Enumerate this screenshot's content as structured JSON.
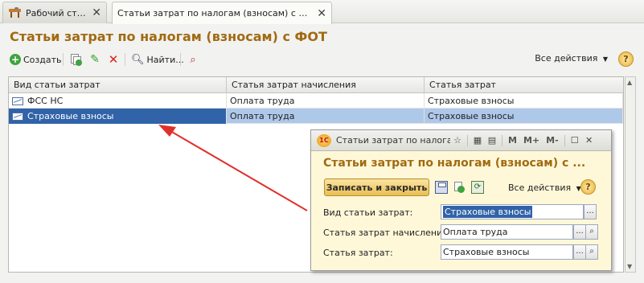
{
  "tabs": [
    {
      "label": "Рабочий стол",
      "close": "✕"
    },
    {
      "label": "Статьи затрат по налогам (взносам) с ФОТ",
      "close": "✕"
    }
  ],
  "page": {
    "title": "Статьи затрат по налогам (взносам) с ФОТ"
  },
  "toolbar": {
    "create_label": "Создать",
    "find_label": "Найти...",
    "all_actions_label": "Все действия",
    "help_label": "?"
  },
  "grid": {
    "columns": [
      "Вид статьи затрат",
      "Статья затрат начисления",
      "Статья затрат"
    ],
    "rows": [
      {
        "kind": "ФСС НС",
        "accrual": "Оплата труда",
        "cost": "Страховые взносы"
      },
      {
        "kind": "Страховые взносы",
        "accrual": "Оплата труда",
        "cost": "Страховые взносы"
      }
    ],
    "selected_row": 1
  },
  "popup": {
    "window_title": "Статьи затрат по налогам...",
    "logo": "1C",
    "m_buttons": [
      "M",
      "M+",
      "M-"
    ],
    "title": "Статьи затрат по налогам (взносам) с ...",
    "save_close_label": "Записать и закрыть",
    "all_actions_label": "Все действия",
    "help_label": "?",
    "fields": [
      {
        "label": "Вид статьи затрат:",
        "value": "Страховые взносы"
      },
      {
        "label": "Статья затрат начисления:",
        "value": "Оплата труда"
      },
      {
        "label": "Статья затрат:",
        "value": "Страховые взносы"
      }
    ]
  },
  "colors": {
    "title": "#a16a12",
    "selection": "#3163a8",
    "row_highlight": "#aec8ea",
    "popup_bg": "#fff8d8",
    "arrow": "#e0302b"
  }
}
